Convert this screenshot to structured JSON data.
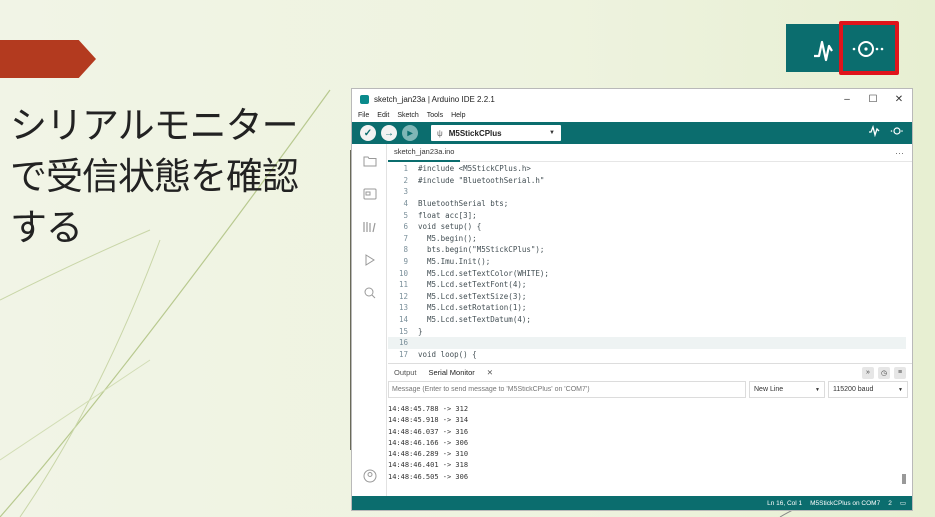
{
  "slide": {
    "title": "シリアルモニター\nで受信状態を確認\nする"
  },
  "ide": {
    "window_title": "sketch_jan23a | Arduino IDE 2.2.1",
    "window_controls": [
      "–",
      "☐",
      "✕"
    ],
    "menu": [
      "File",
      "Edit",
      "Sketch",
      "Tools",
      "Help"
    ],
    "board": "M5StickCPlus",
    "file_tab": "sketch_jan23a.ino",
    "tab_more": "···",
    "code_lines": [
      {
        "n": "1",
        "t": "#include <M5StickCPlus.h>"
      },
      {
        "n": "2",
        "t": "#include \"BluetoothSerial.h\""
      },
      {
        "n": "3",
        "t": ""
      },
      {
        "n": "4",
        "t": "BluetoothSerial bts;"
      },
      {
        "n": "5",
        "t": "float acc[3];"
      },
      {
        "n": "6",
        "t": "void setup() {"
      },
      {
        "n": "7",
        "t": "  M5.begin();"
      },
      {
        "n": "8",
        "t": "  bts.begin(\"M5StickCPlus\");"
      },
      {
        "n": "9",
        "t": "  M5.Imu.Init();"
      },
      {
        "n": "10",
        "t": "  M5.Lcd.setTextColor(WHITE);"
      },
      {
        "n": "11",
        "t": "  M5.Lcd.setTextFont(4);"
      },
      {
        "n": "12",
        "t": "  M5.Lcd.setTextSize(3);"
      },
      {
        "n": "13",
        "t": "  M5.Lcd.setRotation(1);"
      },
      {
        "n": "14",
        "t": "  M5.Lcd.setTextDatum(4);"
      },
      {
        "n": "15",
        "t": "}"
      },
      {
        "n": "16",
        "t": ""
      },
      {
        "n": "17",
        "t": "void loop() {"
      }
    ],
    "panel_tabs": {
      "output": "Output",
      "serial": "Serial Monitor",
      "close": "✕"
    },
    "message_placeholder": "Message (Enter to send message to 'M5StickCPlus' on 'COM7')",
    "line_ending": "New Line",
    "baud": "115200 baud",
    "serial_output": [
      "14:48:45.788 -> 312",
      "14:48:45.918 -> 314",
      "14:48:46.037 -> 316",
      "14:48:46.166 -> 306",
      "14:48:46.289 -> 310",
      "14:48:46.401 -> 318",
      "14:48:46.505 -> 306"
    ],
    "status": {
      "position": "Ln 16, Col 1",
      "board_port": "M5StickCPlus on COM7",
      "notifications": "2"
    }
  },
  "colors": {
    "teal": "#0b6d6e",
    "highlight": "#e0141b",
    "arrow": "#b33a1f"
  }
}
